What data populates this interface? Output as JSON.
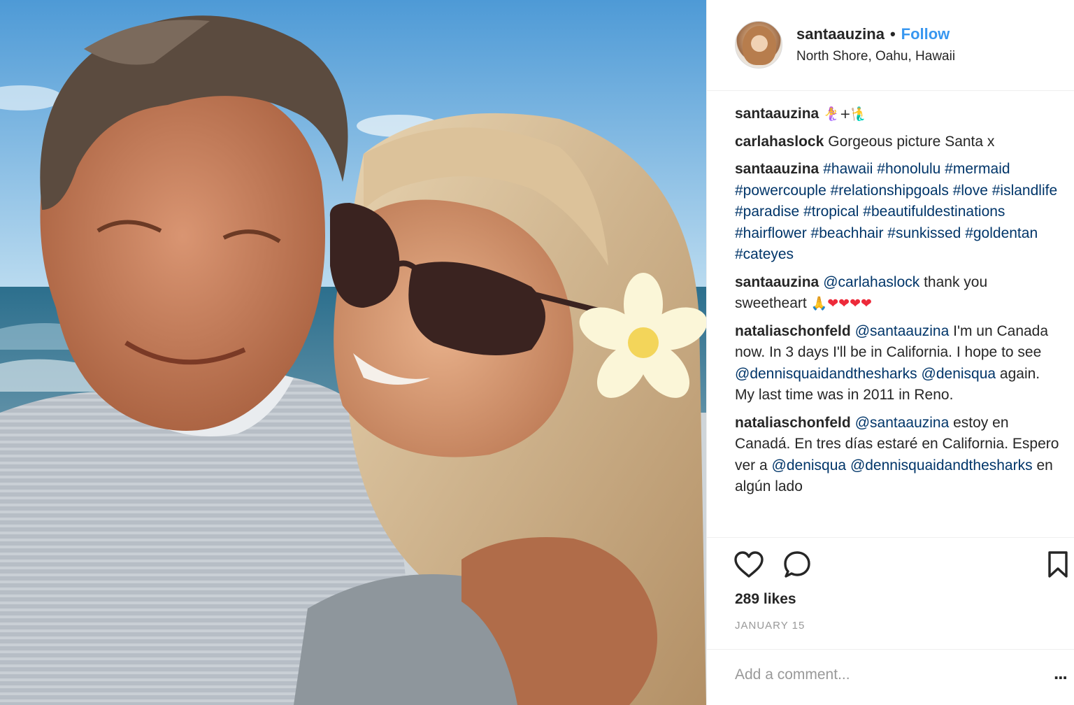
{
  "post": {
    "username": "santaauzina",
    "separator": "•",
    "follow_label": "Follow",
    "location": "North Shore, Oahu, Hawaii"
  },
  "comments": [
    {
      "author": "santaauzina",
      "parts": [
        {
          "t": "emoji",
          "v": "🧜‍♀️+🧜‍♂️"
        }
      ]
    },
    {
      "author": "carlahaslock",
      "parts": [
        {
          "t": "text",
          "v": "Gorgeous picture Santa x"
        }
      ]
    },
    {
      "author": "santaauzina",
      "parts": [
        {
          "t": "tag",
          "v": "#hawaii #honolulu #mermaid #powercouple #relationshipgoals #love #islandlife #paradise #tropical #beautifuldestinations #hairflower #beachhair #sunkissed #goldentan #cateyes"
        }
      ]
    },
    {
      "author": "santaauzina",
      "parts": [
        {
          "t": "tag",
          "v": "@carlahaslock"
        },
        {
          "t": "text",
          "v": " thank you sweetheart "
        },
        {
          "t": "emoji",
          "v": "🙏"
        },
        {
          "t": "heart",
          "v": "❤❤❤❤"
        }
      ]
    },
    {
      "author": "nataliaschonfeld",
      "parts": [
        {
          "t": "tag",
          "v": "@santaauzina"
        },
        {
          "t": "text",
          "v": " I'm un Canada now. In 3 days I'll be in California. I hope to see "
        },
        {
          "t": "tag",
          "v": "@dennisquaidandthesharks"
        },
        {
          "t": "text",
          "v": " "
        },
        {
          "t": "tag",
          "v": "@denisqua"
        },
        {
          "t": "text",
          "v": " again. My last time was in 2011 in Reno."
        }
      ]
    },
    {
      "author": "nataliaschonfeld",
      "parts": [
        {
          "t": "tag",
          "v": "@santaauzina"
        },
        {
          "t": "text",
          "v": " estoy en Canadá. En tres días estaré en California. Espero ver a "
        },
        {
          "t": "tag",
          "v": "@denisqua"
        },
        {
          "t": "text",
          "v": " "
        },
        {
          "t": "tag",
          "v": "@dennisquaidandthesharks"
        },
        {
          "t": "text",
          "v": " en algún lado"
        }
      ]
    }
  ],
  "engagement": {
    "likes": "289 likes",
    "date": "JANUARY 15"
  },
  "add_comment": {
    "placeholder": "Add a comment...",
    "more": "..."
  },
  "icons": {
    "like": "heart-outline-icon",
    "comment": "speech-bubble-icon",
    "save": "bookmark-icon",
    "more": "ellipsis-icon"
  },
  "colors": {
    "link": "#003569",
    "follow": "#3897f0",
    "muted": "#999999",
    "heart": "#ed2a3a"
  }
}
